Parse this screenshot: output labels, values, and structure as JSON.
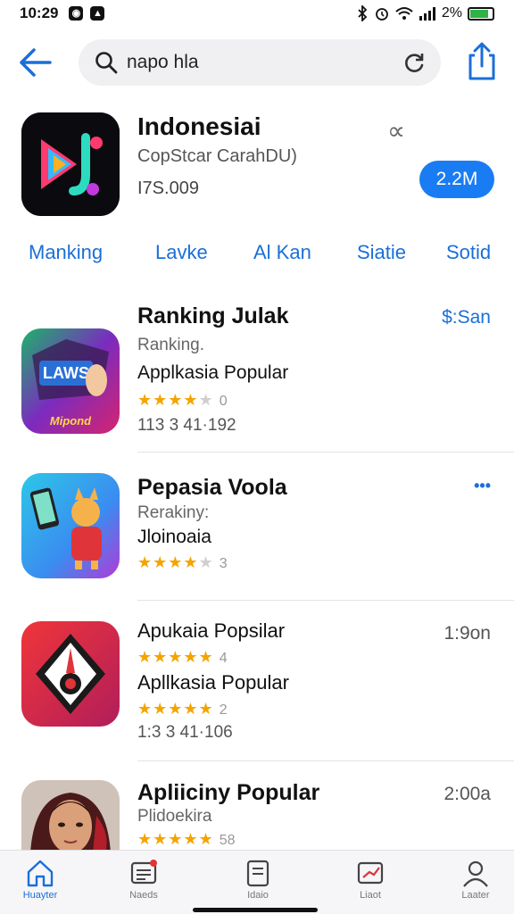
{
  "status_bar": {
    "time": "10:29",
    "battery": "2%"
  },
  "search": {
    "query": "napo hla"
  },
  "featured": {
    "title": "Indonesiai",
    "subtitle": "CopStcar CarahDU)",
    "count": "I7S.009",
    "action_label": "2.2M",
    "close_symbol": "∝"
  },
  "tabs": [
    "Manking",
    "Lavke",
    "Al Kan",
    "Siatie",
    "Sotid"
  ],
  "apps": [
    {
      "title": "Ranking Julak",
      "subtitle": "Ranking.",
      "body": "Applkasia Popular",
      "rating_count": "0",
      "meta": "113 3 41·192",
      "right": "$:San",
      "icon_text": "LAWS",
      "icon_caption": "Mipond"
    },
    {
      "title": "Pepasia Voola",
      "subtitle": "Rerakiny:",
      "body": "Jloinoaia",
      "rating_count": "3",
      "right": "•••"
    },
    {
      "title": "Apukaia Popsilar",
      "rating_count_a": "4",
      "body": "Apllkasia Popular",
      "rating_count_b": "2",
      "meta": "1:3 3 41·106",
      "right": "1:9on"
    },
    {
      "title": "Apliiciny Popular",
      "subtitle": "Plidoekira",
      "rating_count": "58",
      "right": "2:00a"
    }
  ],
  "bottom_nav": [
    "Huayter",
    "Naeds",
    "Idaio",
    "Liaot",
    "Laater"
  ],
  "colors": {
    "accent": "#1a7cf2",
    "star": "#f4a400"
  }
}
